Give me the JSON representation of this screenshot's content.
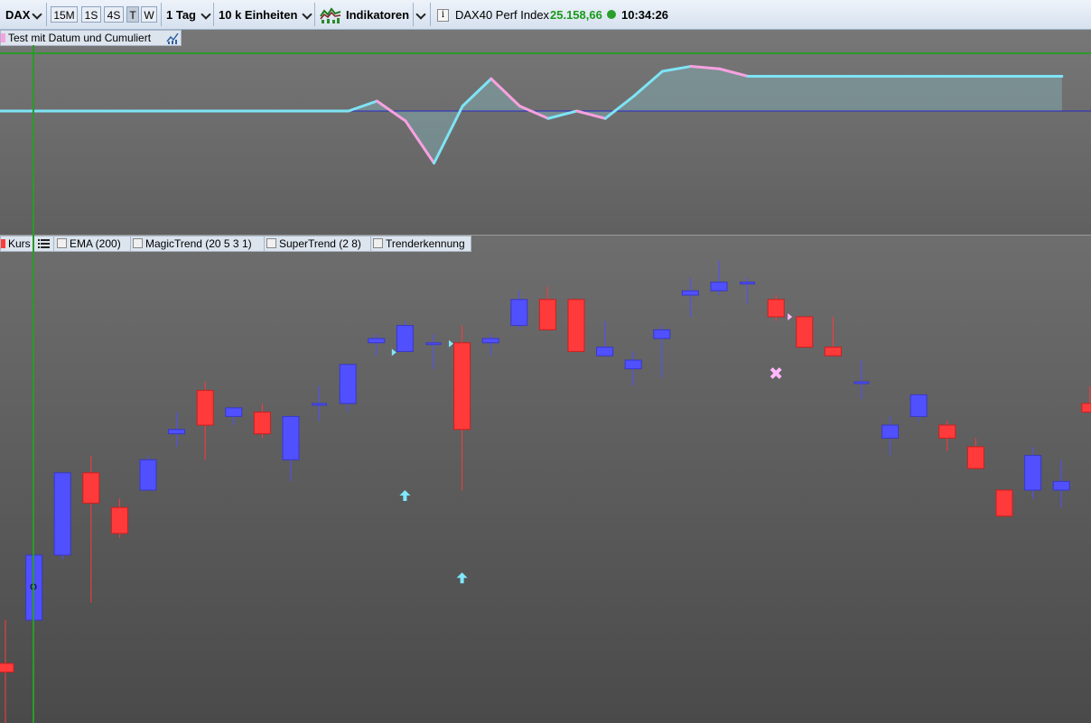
{
  "toolbar": {
    "symbol": "DAX",
    "intervals": [
      "15M",
      "1S",
      "4S",
      "T",
      "W"
    ],
    "selected_interval": "T",
    "period": "1 Tag",
    "units": "10 k Einheiten",
    "indicators_label": "Indikatoren",
    "instrument": "DAX40 Perf Index",
    "price": "25.158,66",
    "time": "10:34:26",
    "colors": {
      "price": "#1a9a1a"
    }
  },
  "indicator_pane": {
    "legend": "Test mit Datum und Cumuliert",
    "series_colors": {
      "up": "#7ee4f5",
      "down": "#f7a1e0",
      "baseline": "#2828c8",
      "top_line": "#2a9a2a"
    },
    "values": [
      0,
      0,
      0,
      0,
      0,
      0,
      0,
      0,
      0,
      0,
      0,
      0,
      0,
      0,
      0.2,
      -0.2,
      -1.05,
      0.1,
      0.65,
      0.1,
      -0.15,
      0,
      -0.15,
      0.3,
      0.8,
      0.9,
      0.85,
      0.7,
      0.7,
      0.7,
      0.7,
      0.7,
      0.7,
      0.7,
      0.7,
      0.7,
      0.7,
      0.7,
      0.7
    ]
  },
  "price_pane": {
    "legend": {
      "kurs": "Kurs",
      "items": [
        "EMA (200)",
        "MagicTrend (20 5 3 1)",
        "SuperTrend (2 8)",
        "Trenderkennung"
      ]
    },
    "colors": {
      "bull": "#5050ff",
      "bear": "#ff3a3a",
      "cursor": "#2a9a2a",
      "signal": "#80e8ff",
      "exit": "#ffb8ff"
    },
    "candles": [
      {
        "o": 0.0,
        "h": 1.0,
        "l": -1.5,
        "c": -0.2
      },
      {
        "o": 1.0,
        "h": 2.4,
        "l": 0.9,
        "c": 2.5
      },
      {
        "o": 2.5,
        "h": 4.0,
        "l": 2.4,
        "c": 4.4
      },
      {
        "o": 4.4,
        "h": 4.8,
        "l": 1.4,
        "c": 3.7
      },
      {
        "o": 3.6,
        "h": 3.8,
        "l": 2.9,
        "c": 3.0
      },
      {
        "o": 4.0,
        "h": 4.8,
        "l": 4.0,
        "c": 4.7
      },
      {
        "o": 5.3,
        "h": 5.8,
        "l": 5.0,
        "c": 5.4
      },
      {
        "o": 6.3,
        "h": 6.5,
        "l": 4.7,
        "c": 5.5
      },
      {
        "o": 5.7,
        "h": 5.9,
        "l": 5.5,
        "c": 5.9
      },
      {
        "o": 5.8,
        "h": 6.0,
        "l": 5.2,
        "c": 5.3
      },
      {
        "o": 4.7,
        "h": 4.4,
        "l": 4.2,
        "c": 5.7
      },
      {
        "o": 6.0,
        "h": 6.4,
        "l": 5.6,
        "c": 6.0
      },
      {
        "o": 6.0,
        "h": 6.9,
        "l": 5.8,
        "c": 6.9
      },
      {
        "o": 7.4,
        "h": 7.6,
        "l": 7.1,
        "c": 7.5
      },
      {
        "o": 7.2,
        "h": 7.9,
        "l": 7.2,
        "c": 7.8
      },
      {
        "o": 7.4,
        "h": 7.6,
        "l": 6.8,
        "c": 7.4
      },
      {
        "o": 7.4,
        "h": 7.8,
        "l": 4.0,
        "c": 5.4
      },
      {
        "o": 7.4,
        "h": 7.6,
        "l": 7.1,
        "c": 7.5
      },
      {
        "o": 7.8,
        "h": 8.6,
        "l": 7.7,
        "c": 8.4
      },
      {
        "o": 8.4,
        "h": 8.7,
        "l": 7.7,
        "c": 7.7
      },
      {
        "o": 8.4,
        "h": 8.4,
        "l": 7.2,
        "c": 7.2
      },
      {
        "o": 7.1,
        "h": 7.9,
        "l": 7.1,
        "c": 7.3
      },
      {
        "o": 6.8,
        "h": 7.2,
        "l": 6.4,
        "c": 7.0
      },
      {
        "o": 7.5,
        "h": 7.8,
        "l": 6.6,
        "c": 7.7
      },
      {
        "o": 8.5,
        "h": 8.9,
        "l": 8.0,
        "c": 8.6
      },
      {
        "o": 8.6,
        "h": 9.3,
        "l": 8.5,
        "c": 8.8
      },
      {
        "o": 8.8,
        "h": 8.9,
        "l": 8.3,
        "c": 8.8
      },
      {
        "o": 8.4,
        "h": 8.5,
        "l": 7.9,
        "c": 8.0
      },
      {
        "o": 8.0,
        "h": 8.0,
        "l": 7.3,
        "c": 7.3
      },
      {
        "o": 7.3,
        "h": 8.0,
        "l": 7.1,
        "c": 7.1
      },
      {
        "o": 6.5,
        "h": 7.0,
        "l": 6.1,
        "c": 6.5
      },
      {
        "o": 5.2,
        "h": 5.7,
        "l": 4.8,
        "c": 5.5
      },
      {
        "o": 5.7,
        "h": 6.1,
        "l": 5.6,
        "c": 6.2
      },
      {
        "o": 5.5,
        "h": 5.6,
        "l": 4.9,
        "c": 5.2
      },
      {
        "o": 5.0,
        "h": 5.2,
        "l": 4.5,
        "c": 4.5
      },
      {
        "o": 4.0,
        "h": 4.0,
        "l": 3.4,
        "c": 3.4
      },
      {
        "o": 4.0,
        "h": 5.0,
        "l": 3.8,
        "c": 4.8
      },
      {
        "o": 4.0,
        "h": 4.7,
        "l": 3.6,
        "c": 4.2
      },
      {
        "o": 6.0,
        "h": 6.4,
        "l": 5.8,
        "c": 5.8
      }
    ]
  }
}
